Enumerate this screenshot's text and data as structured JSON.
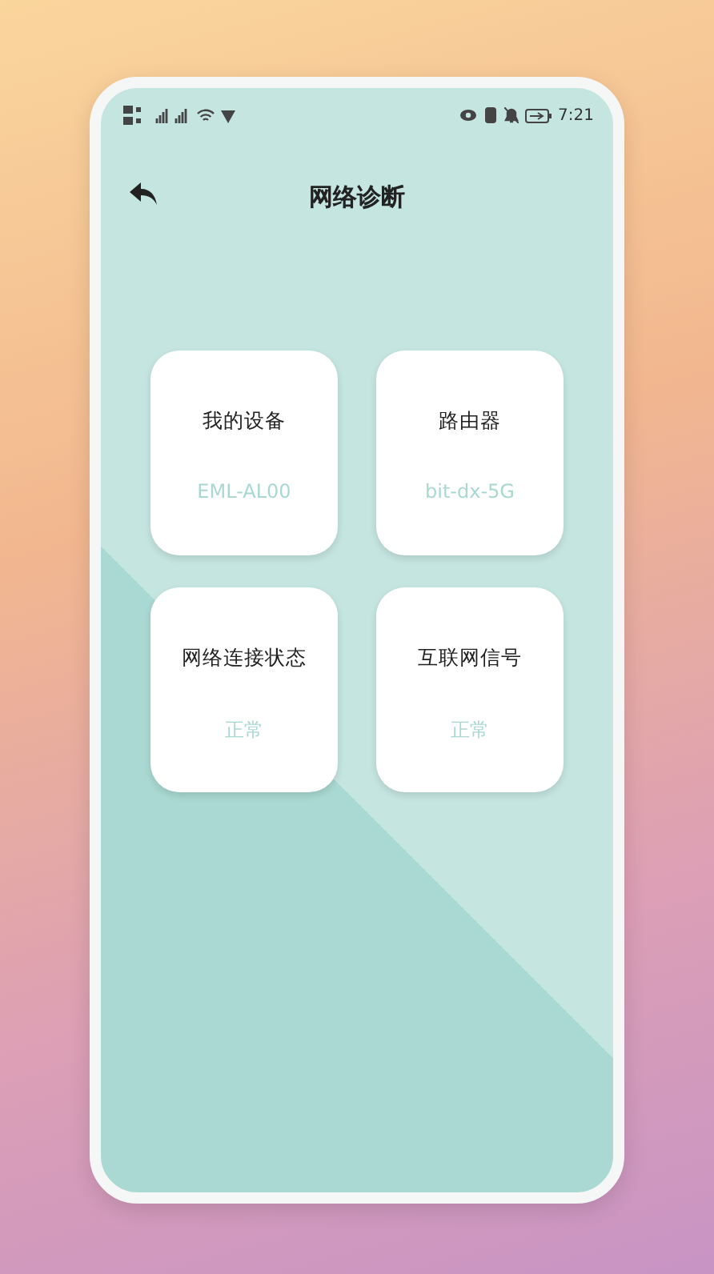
{
  "status_bar": {
    "time": "7:21"
  },
  "header": {
    "title": "网络诊断"
  },
  "cards": [
    {
      "label": "我的设备",
      "value": "EML-AL00"
    },
    {
      "label": "路由器",
      "value": "bit-dx-5G"
    },
    {
      "label": "网络连接状态",
      "value": "正常"
    },
    {
      "label": "互联网信号",
      "value": "正常"
    }
  ]
}
